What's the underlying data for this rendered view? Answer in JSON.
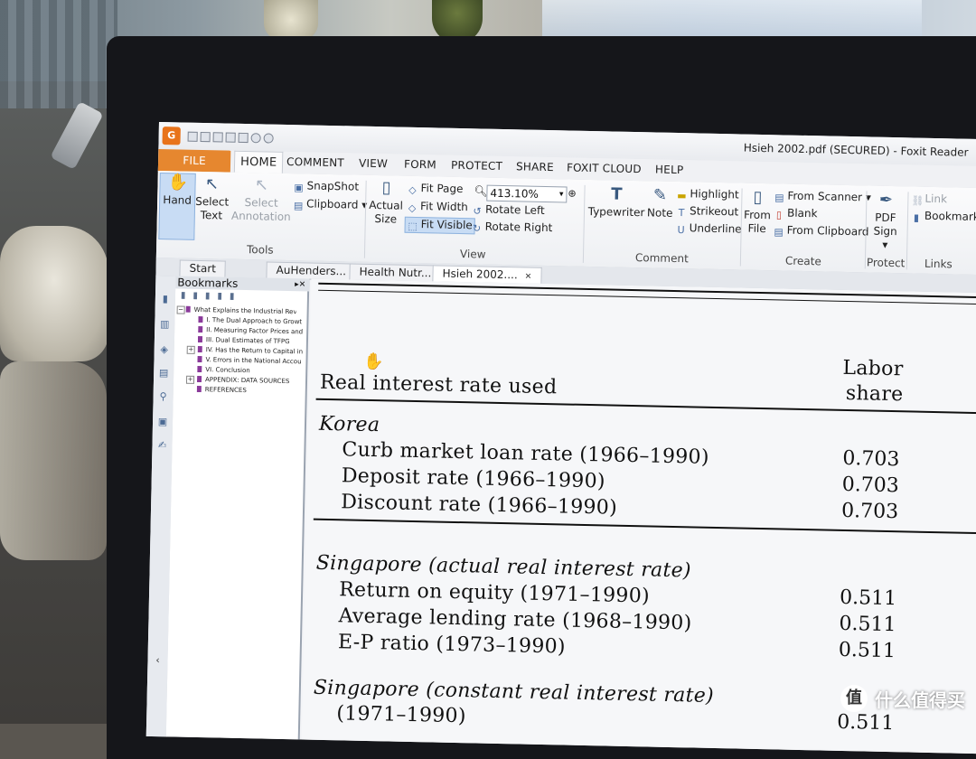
{
  "app": {
    "window_title": "Hsieh 2002.pdf (SECURED) - Foxit Reader",
    "app_icon_text": "G"
  },
  "menu_tabs": [
    "FILE",
    "HOME",
    "COMMENT",
    "VIEW",
    "FORM",
    "PROTECT",
    "SHARE",
    "FOXIT CLOUD",
    "HELP"
  ],
  "ribbon": {
    "tools": {
      "hand": "Hand",
      "select_text_1": "Select",
      "select_text_2": "Text",
      "select_annotation_1": "Select",
      "select_annotation_2": "Annotation",
      "snapshot": "SnapShot",
      "clipboard": "Clipboard",
      "group": "Tools"
    },
    "view": {
      "actual_size_1": "Actual",
      "actual_size_2": "Size",
      "fit_page": "Fit Page",
      "fit_width": "Fit Width",
      "fit_visible": "Fit Visible",
      "zoom": "413.10%",
      "rotate_left": "Rotate Left",
      "rotate_right": "Rotate Right",
      "group": "View"
    },
    "comment": {
      "typewriter": "Typewriter",
      "note": "Note",
      "highlight": "Highlight",
      "strikeout": "Strikeout",
      "underline": "Underline",
      "group": "Comment"
    },
    "create": {
      "from_file_1": "From",
      "from_file_2": "File",
      "from_scanner": "From Scanner",
      "blank": "Blank",
      "from_clipboard": "From Clipboard",
      "group": "Create"
    },
    "protect": {
      "pdf_sign_1": "PDF",
      "pdf_sign_2": "Sign",
      "group": "Protect"
    },
    "links": {
      "link": "Link",
      "bookmark": "Bookmark",
      "group": "Links"
    }
  },
  "doc_tabs": [
    "Start",
    "AuHenders...",
    "Health Nutr...",
    "Hsieh 2002...."
  ],
  "bookmarks": {
    "title": "Bookmarks",
    "items": [
      "What Explains the Industrial Revolu",
      "I. The Dual Approach to Growt",
      "II. Measuring Factor Prices and",
      "III. Dual Estimates of TFPG",
      "IV. Has the Return to Capital in",
      "V. Errors in the National Accou",
      "VI. Conclusion",
      "APPENDIX: DATA SOURCES",
      "REFERENCES"
    ]
  },
  "document": {
    "col_header_1": "Real interest rate used",
    "col_header_2a": "Labor",
    "col_header_2b": "share",
    "korea": "Korea",
    "korea_rows": [
      {
        "label": "Curb market loan rate (1966–1990)",
        "value": "0.703"
      },
      {
        "label": "Deposit rate (1966–1990)",
        "value": "0.703"
      },
      {
        "label": "Discount rate (1966–1990)",
        "value": "0.703"
      }
    ],
    "singapore_actual": "Singapore (actual real interest rate)",
    "singapore_rows": [
      {
        "label": "Return on equity (1971–1990)",
        "value": "0.511"
      },
      {
        "label": "Average lending rate (1968–1990)",
        "value": "0.511"
      },
      {
        "label": "E-P ratio (1973–1990)",
        "value": "0.511"
      }
    ],
    "singapore_constant": "Singapore (constant real interest rate)",
    "last_row_label": "(1971–1990)",
    "last_row_value": "0.511"
  },
  "watermark": {
    "logo": "值",
    "text": "什么值得买"
  }
}
